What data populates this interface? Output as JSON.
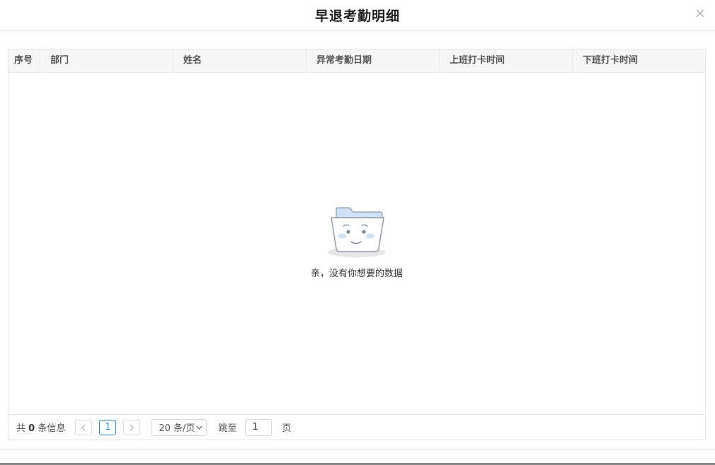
{
  "dialog": {
    "title": "早退考勤明细",
    "close_icon": "close-icon"
  },
  "table": {
    "columns": [
      "序号",
      "部门",
      "姓名",
      "异常考勤日期",
      "上班打卡时间",
      "下班打卡时间"
    ],
    "rows": [],
    "empty": {
      "icon": "empty-folder-icon",
      "text": "亲，没有你想要的数据"
    }
  },
  "pagination": {
    "total_prefix": "共",
    "total_count": "0",
    "total_suffix": "条信息",
    "prev_icon": "chevron-left-icon",
    "current_page": "1",
    "next_icon": "chevron-right-icon",
    "page_size": "20 条/页",
    "jump_label": "跳至",
    "jump_value": "1",
    "page_suffix": "页"
  },
  "colors": {
    "accent": "#1e88e5",
    "header_bg": "#f7f7f7",
    "border": "#e4e4e4"
  }
}
